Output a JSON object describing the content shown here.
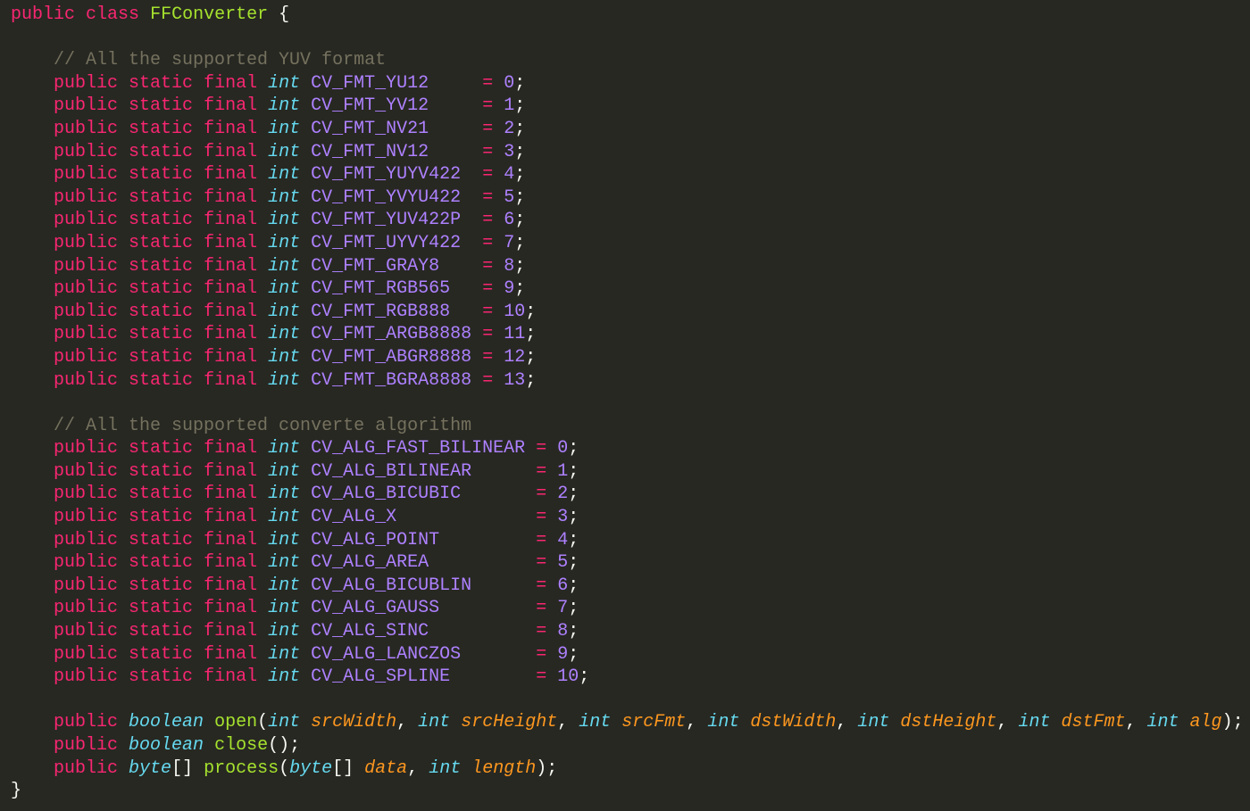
{
  "class_header": {
    "modifier": "public",
    "keyword": "class",
    "name": "FFConverter",
    "open_brace": "{"
  },
  "fmt_comment": "// All the supported YUV format",
  "fmt_constants": [
    {
      "name": "CV_FMT_YU12",
      "pad": "     ",
      "value": "0"
    },
    {
      "name": "CV_FMT_YV12",
      "pad": "     ",
      "value": "1"
    },
    {
      "name": "CV_FMT_NV21",
      "pad": "     ",
      "value": "2"
    },
    {
      "name": "CV_FMT_NV12",
      "pad": "     ",
      "value": "3"
    },
    {
      "name": "CV_FMT_YUYV422",
      "pad": "  ",
      "value": "4"
    },
    {
      "name": "CV_FMT_YVYU422",
      "pad": "  ",
      "value": "5"
    },
    {
      "name": "CV_FMT_YUV422P",
      "pad": "  ",
      "value": "6"
    },
    {
      "name": "CV_FMT_UYVY422",
      "pad": "  ",
      "value": "7"
    },
    {
      "name": "CV_FMT_GRAY8",
      "pad": "    ",
      "value": "8"
    },
    {
      "name": "CV_FMT_RGB565",
      "pad": "   ",
      "value": "9"
    },
    {
      "name": "CV_FMT_RGB888",
      "pad": "   ",
      "value": "10"
    },
    {
      "name": "CV_FMT_ARGB8888",
      "pad": " ",
      "value": "11"
    },
    {
      "name": "CV_FMT_ABGR8888",
      "pad": " ",
      "value": "12"
    },
    {
      "name": "CV_FMT_BGRA8888",
      "pad": " ",
      "value": "13"
    }
  ],
  "alg_comment": "// All the supported converte algorithm",
  "alg_constants": [
    {
      "name": "CV_ALG_FAST_BILINEAR",
      "pad": " ",
      "value": "0"
    },
    {
      "name": "CV_ALG_BILINEAR",
      "pad": "      ",
      "value": "1"
    },
    {
      "name": "CV_ALG_BICUBIC",
      "pad": "       ",
      "value": "2"
    },
    {
      "name": "CV_ALG_X",
      "pad": "             ",
      "value": "3"
    },
    {
      "name": "CV_ALG_POINT",
      "pad": "         ",
      "value": "4"
    },
    {
      "name": "CV_ALG_AREA",
      "pad": "          ",
      "value": "5"
    },
    {
      "name": "CV_ALG_BICUBLIN",
      "pad": "      ",
      "value": "6"
    },
    {
      "name": "CV_ALG_GAUSS",
      "pad": "         ",
      "value": "7"
    },
    {
      "name": "CV_ALG_SINC",
      "pad": "          ",
      "value": "8"
    },
    {
      "name": "CV_ALG_LANCZOS",
      "pad": "       ",
      "value": "9"
    },
    {
      "name": "CV_ALG_SPLINE",
      "pad": "        ",
      "value": "10"
    }
  ],
  "field_prefix": {
    "kw1": "public",
    "kw2": "static",
    "kw3": "final",
    "type": "int",
    "assign": "=",
    "semi": ";"
  },
  "methods": {
    "open": {
      "modifier": "public",
      "return_type": "boolean",
      "name": "open",
      "params": [
        {
          "type": "int",
          "name": "srcWidth"
        },
        {
          "type": "int",
          "name": "srcHeight"
        },
        {
          "type": "int",
          "name": "srcFmt"
        },
        {
          "type": "int",
          "name": "dstWidth"
        },
        {
          "type": "int",
          "name": "dstHeight"
        },
        {
          "type": "int",
          "name": "dstFmt"
        },
        {
          "type": "int",
          "name": "alg"
        }
      ]
    },
    "close": {
      "modifier": "public",
      "return_type": "boolean",
      "name": "close"
    },
    "process": {
      "modifier": "public",
      "return_type": "byte",
      "array": "[]",
      "name": "process",
      "params": [
        {
          "type": "byte",
          "array": "[]",
          "name": "data"
        },
        {
          "type": "int",
          "name": "length"
        }
      ]
    }
  },
  "close_brace": "}",
  "colors": {
    "background": "#272822",
    "keyword": "#f92672",
    "type": "#66d9ef",
    "class_name": "#a6e22e",
    "constant": "#ae81ff",
    "comment": "#75715e",
    "param": "#fd971f",
    "text": "#f8f8f2"
  }
}
